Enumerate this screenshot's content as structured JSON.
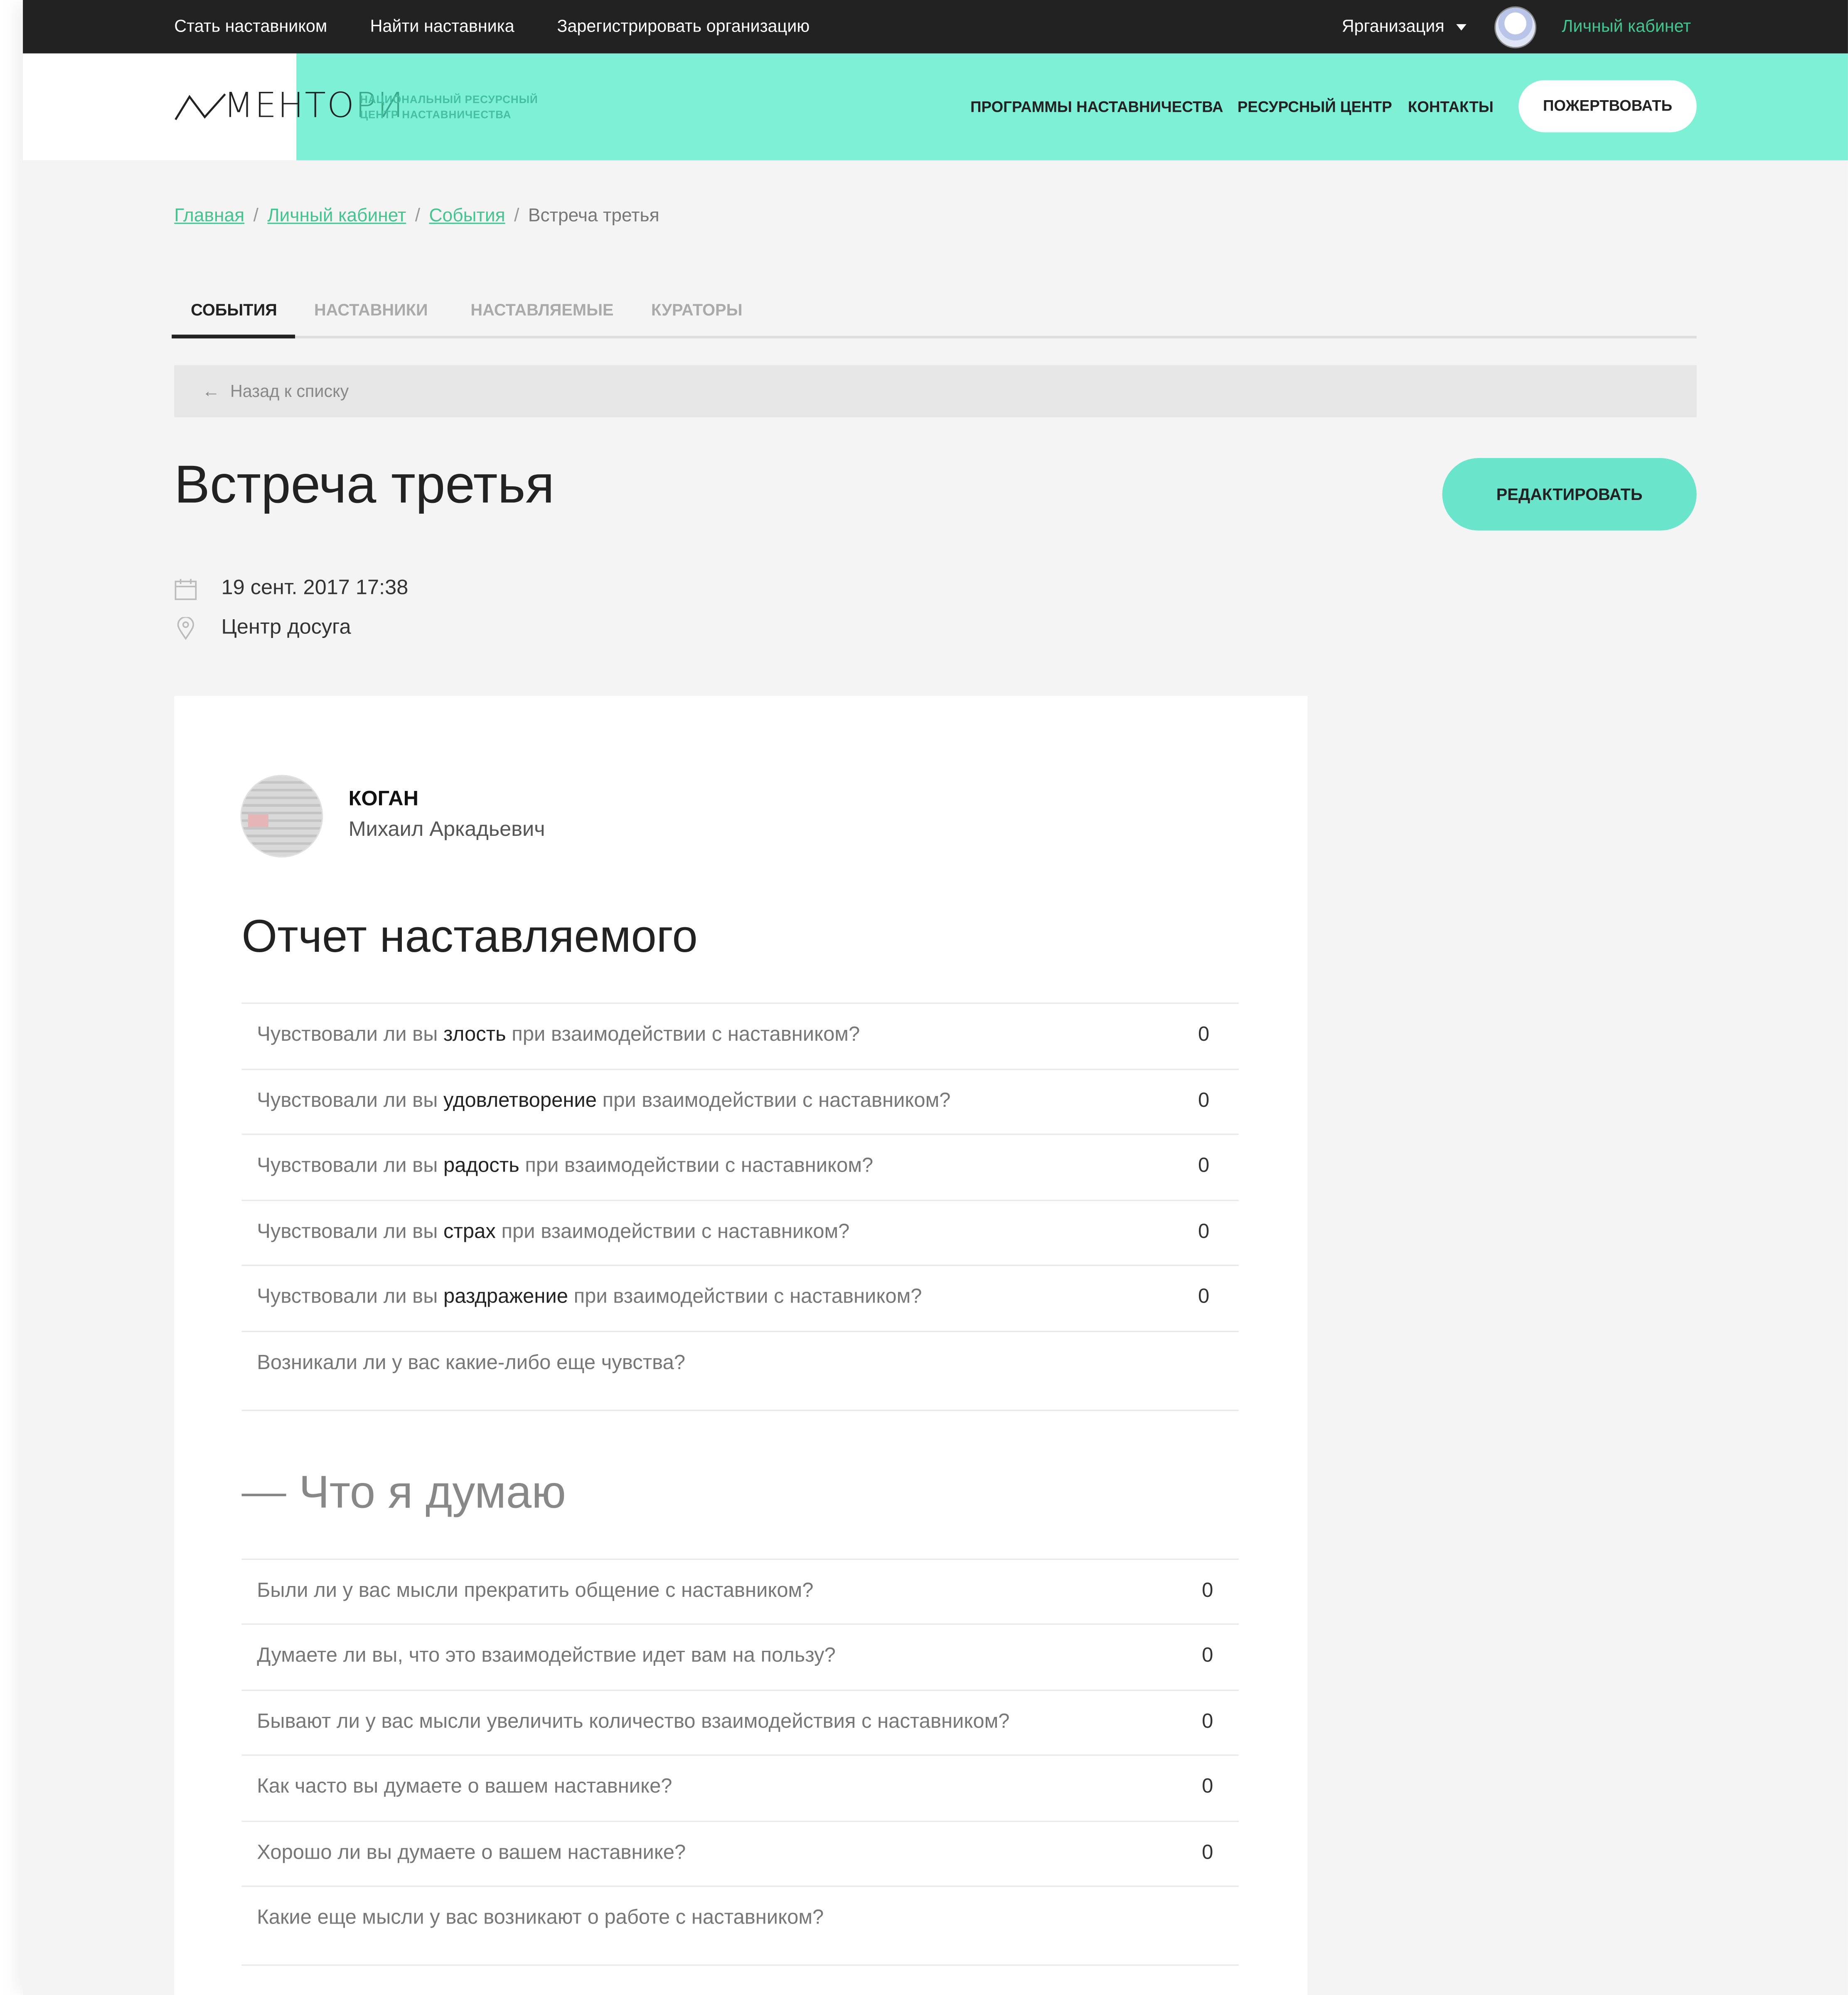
{
  "topbar": {
    "links": [
      "Стать наставником",
      "Найти наставника",
      "Зарегистрировать организацию"
    ],
    "org": "Ярганизация",
    "cabinet": "Личный кабинет"
  },
  "header": {
    "logo_word_head": "МЕНТО",
    "logo_word_tail": "РИ",
    "logo_sub_1": "НАЦИОНАЛЬНЫЙ РЕСУРСНЫЙ",
    "logo_sub_2": "ЦЕНТР НАСТАВНИЧЕСТВА",
    "nav": [
      "ПРОГРАММЫ НАСТАВНИЧЕСТВА",
      "РЕСУРСНЫЙ ЦЕНТР",
      "КОНТАКТЫ"
    ],
    "donate": "ПОЖЕРТВОВАТЬ"
  },
  "breadcrumbs": {
    "items": [
      "Главная",
      "Личный кабинет",
      "События"
    ],
    "separator": "/",
    "current": "Встреча третья"
  },
  "tabs": [
    "СОБЫТИЯ",
    "НАСТАВНИКИ",
    "НАСТАВЛЯЕМЫЕ",
    "КУРАТОРЫ"
  ],
  "active_tab": "СОБЫТИЯ",
  "back": {
    "arrow": "←",
    "label": "Назад к списку"
  },
  "event": {
    "title": "Встреча третья",
    "edit": "РЕДАКТИРОВАТЬ",
    "date": "19 сент. 2017 17:38",
    "place": "Центр досуга"
  },
  "user": {
    "surname": "КОГАН",
    "given": "Михаил Аркадьевич"
  },
  "report": {
    "title": "Отчет наставляемого",
    "rows": [
      {
        "pre": "Чувствовали ли вы ",
        "em": "злость",
        "post": " при взаимодействии с наставником?",
        "value": "0"
      },
      {
        "pre": "Чувствовали ли вы ",
        "em": "удовлетворение",
        "post": " при взаимодействии с наставником?",
        "value": "0"
      },
      {
        "pre": "Чувствовали ли вы ",
        "em": "радость",
        "post": " при взаимодействии с наставником?",
        "value": "0"
      },
      {
        "pre": "Чувствовали ли вы ",
        "em": "страх",
        "post": " при взаимодействии с наставником?",
        "value": "0"
      },
      {
        "pre": "Чувствовали ли вы ",
        "em": "раздражение",
        "post": " при взаимодействии с наставником?",
        "value": "0"
      },
      {
        "pre": "Возникали ли у вас какие-либо еще чувства?",
        "em": "",
        "post": "",
        "value": ""
      }
    ]
  },
  "thoughts": {
    "title": "Что я думаю",
    "rows": [
      {
        "q": "Были ли у вас мысли прекратить общение с наставником?",
        "value": "0"
      },
      {
        "q": "Думаете ли вы, что это взаимодействие идет вам на пользу?",
        "value": "0"
      },
      {
        "q": "Бывают ли у вас мысли увеличить количество взаимодействия с наставником?",
        "value": "0"
      },
      {
        "q": "Как часто вы думаете о вашем наставнике?",
        "value": "0"
      },
      {
        "q": "Хорошо ли вы думаете о вашем наставнике?",
        "value": "0"
      },
      {
        "q": "Какие еще мысли у вас возникают о работе с наставником?",
        "value": ""
      }
    ]
  },
  "colors": {
    "accent_mint": "#7df0d6",
    "edit_button": "#6ae5cc",
    "link_green": "#46c48f",
    "topbar": "#222222"
  },
  "icons": {
    "calendar": "calendar-icon",
    "location": "location-pin-icon",
    "back": "arrow-left-icon",
    "dropdown": "chevron-down-icon"
  }
}
